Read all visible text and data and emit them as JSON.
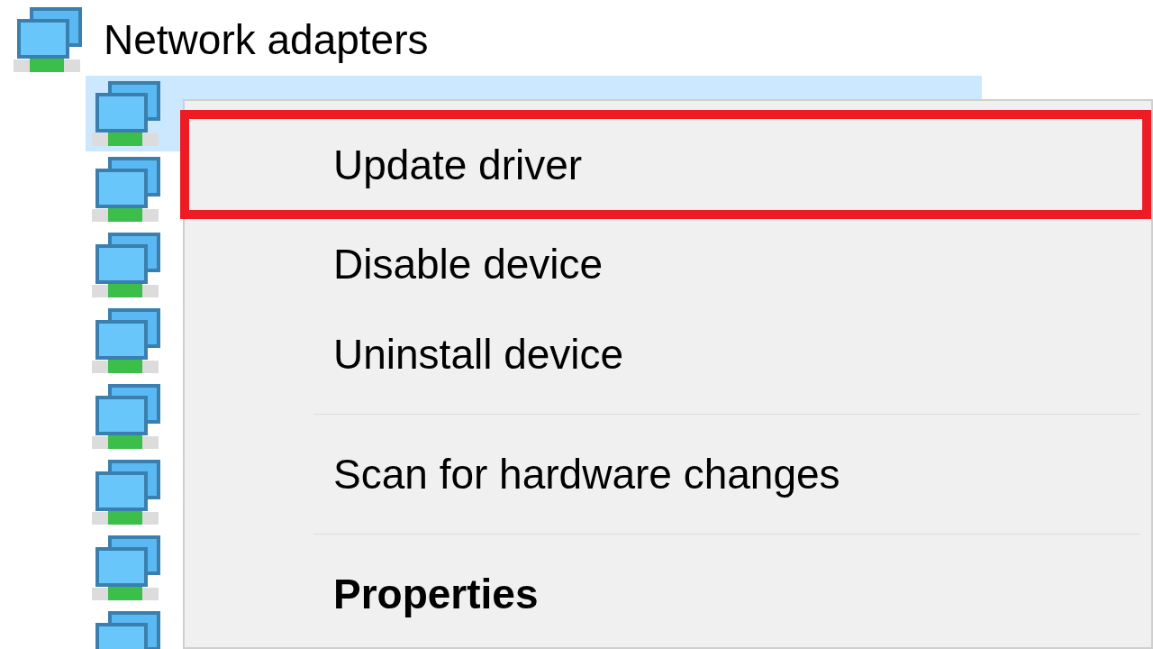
{
  "tree": {
    "category": {
      "label": "Network adapters",
      "children": [
        {
          "selected": true
        },
        {
          "selected": false
        },
        {
          "selected": false
        },
        {
          "selected": false
        },
        {
          "selected": false
        },
        {
          "selected": false
        },
        {
          "selected": false
        },
        {
          "selected": false
        }
      ]
    }
  },
  "context_menu": {
    "items": [
      {
        "kind": "item",
        "label": "Update driver",
        "highlighted": true,
        "default": false
      },
      {
        "kind": "item",
        "label": "Disable device",
        "highlighted": false,
        "default": false
      },
      {
        "kind": "item",
        "label": "Uninstall device",
        "highlighted": false,
        "default": false
      },
      {
        "kind": "separator"
      },
      {
        "kind": "item",
        "label": "Scan for hardware changes",
        "highlighted": false,
        "default": false
      },
      {
        "kind": "separator"
      },
      {
        "kind": "item",
        "label": "Properties",
        "highlighted": false,
        "default": true
      }
    ]
  }
}
